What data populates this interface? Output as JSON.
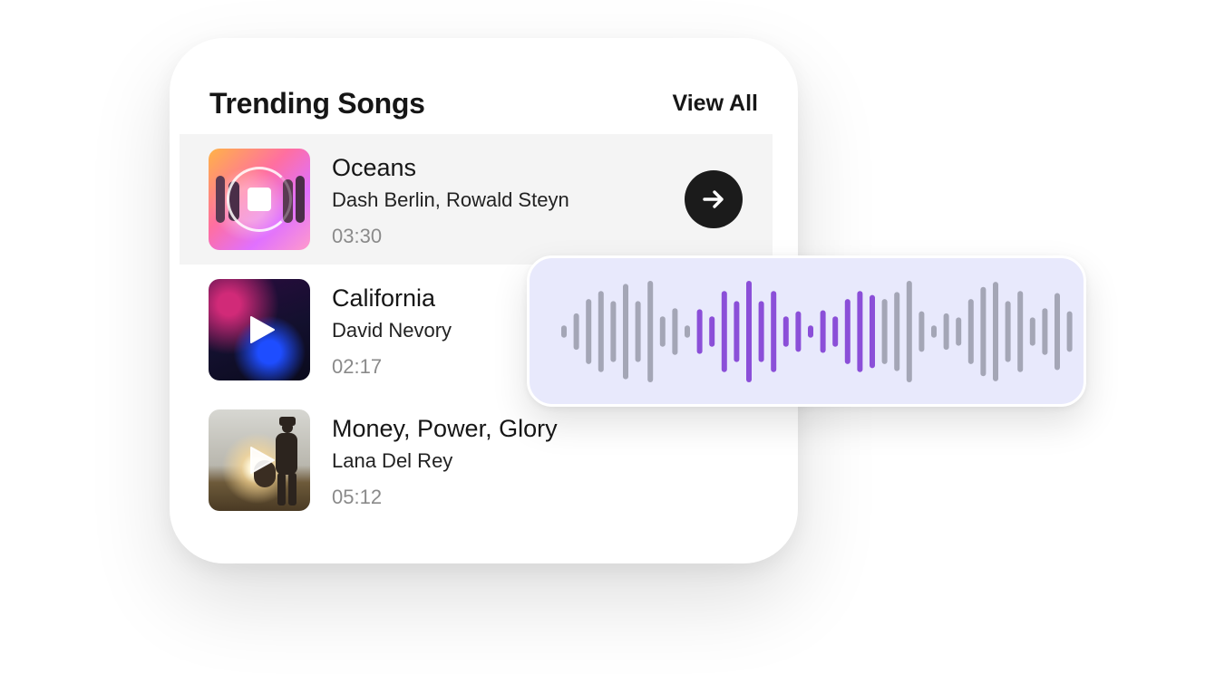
{
  "header": {
    "title": "Trending Songs",
    "view_all_label": "View All"
  },
  "songs": [
    {
      "title": "Oceans",
      "artist": "Dash Berlin, Rowald Steyn",
      "duration": "03:30",
      "state": "playing"
    },
    {
      "title": "California",
      "artist": "David Nevory",
      "duration": "02:17",
      "state": "paused"
    },
    {
      "title": "Money, Power, Glory",
      "artist": "Lana Del Rey",
      "duration": "05:12",
      "state": "paused"
    }
  ],
  "waveform": {
    "colors": {
      "inactive": "#a4a6b6",
      "active": "#8b4fd8"
    },
    "levels": [
      0.12,
      0.36,
      0.64,
      0.8,
      0.6,
      0.94,
      0.6,
      1.0,
      0.3,
      0.46,
      0.12,
      0.44,
      0.3,
      0.8,
      0.6,
      1.0,
      0.6,
      0.8,
      0.3,
      0.4,
      0.12,
      0.42,
      0.3,
      0.64,
      0.8,
      0.72,
      0.64,
      0.78,
      1.0,
      0.4,
      0.12,
      0.36,
      0.28,
      0.64,
      0.88,
      0.98,
      0.6,
      0.8,
      0.28,
      0.46,
      0.76,
      0.4
    ],
    "active_range": [
      11,
      25
    ]
  },
  "colors": {
    "accent": "#8b4fd8",
    "row_highlight": "#f4f4f4",
    "button_dark": "#1b1b1b",
    "wave_background": "#e8e9fc"
  },
  "icons": {
    "go": "arrow-right-icon",
    "stop": "stop-icon",
    "play": "play-icon"
  }
}
